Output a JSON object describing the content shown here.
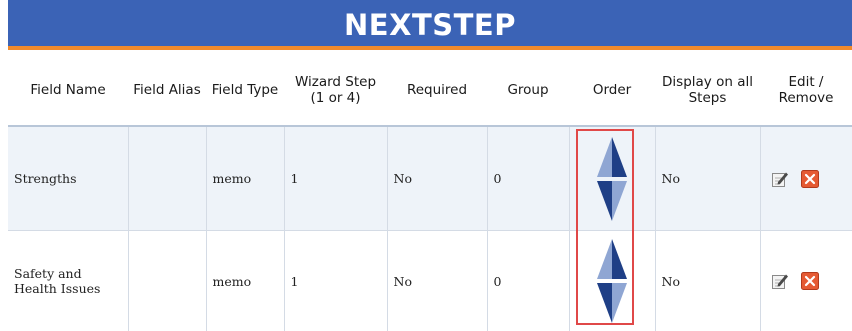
{
  "banner": {
    "title": "NEXTSTEP"
  },
  "columns": [
    "Field Name",
    "Field Alias",
    "Field Type",
    "Wizard Step (1 or 4)",
    "Required",
    "Group",
    "Order",
    "Display on all Steps",
    "Edit / Remove"
  ],
  "rows": [
    {
      "field_name": "Strengths",
      "field_alias": "",
      "field_type": "memo",
      "wizard_step": "1",
      "required": "No",
      "group": "0",
      "display_all": "No"
    },
    {
      "field_name": "Safety and Health Issues",
      "field_alias": "",
      "field_type": "memo",
      "wizard_step": "1",
      "required": "No",
      "group": "0",
      "display_all": "No"
    }
  ],
  "icons": {
    "move_up": "arrow-up-icon",
    "move_down": "arrow-down-icon",
    "edit": "edit-icon",
    "remove": "remove-icon"
  },
  "colors": {
    "banner": "#3b63b6",
    "banner_underline": "#f08a2c",
    "row_shade": "#eef3f9",
    "highlight": "#e04848",
    "arrow_dark": "#1f3f86",
    "arrow_light": "#8fa6d3",
    "remove": "#e55a33"
  }
}
